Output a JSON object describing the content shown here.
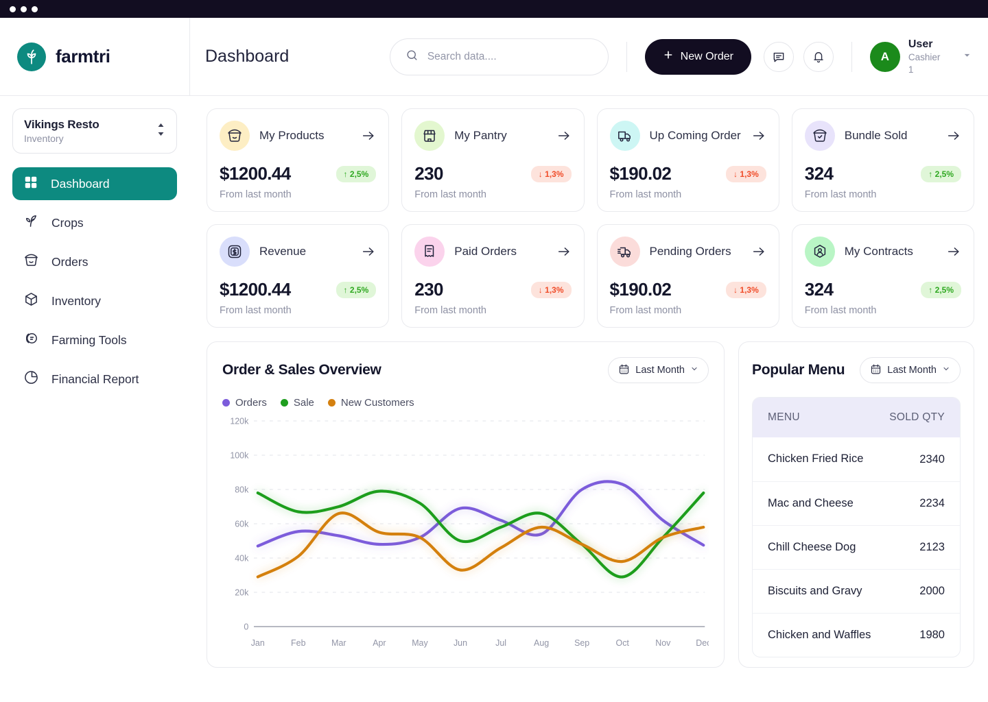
{
  "window": {
    "dots": 3
  },
  "brand": {
    "name": "farmtri",
    "logo_icon": "leaf-plant-icon",
    "color": "#0d8a80"
  },
  "header": {
    "page_title": "Dashboard",
    "search": {
      "placeholder": "Search data....",
      "value": "",
      "icon": "search-icon"
    },
    "new_order_label": "New Order",
    "chat_icon": "chat-bubble-icon",
    "bell_icon": "bell-icon",
    "avatar_initial": "A",
    "avatar_color": "#1b8a1b",
    "user_name": "User",
    "user_role": "Cashier 1",
    "caret_icon": "chevron-down-icon"
  },
  "sidebar": {
    "org": {
      "name": "Vikings Resto",
      "sub": "Inventory",
      "icon": "selector-updown-icon"
    },
    "items": [
      {
        "label": "Dashboard",
        "icon": "grid-icon",
        "active": true
      },
      {
        "label": "Crops",
        "icon": "sprout-icon",
        "active": false
      },
      {
        "label": "Orders",
        "icon": "basket-icon",
        "active": false
      },
      {
        "label": "Inventory",
        "icon": "box-icon",
        "active": false
      },
      {
        "label": "Farming Tools",
        "icon": "tools-icon",
        "active": false
      },
      {
        "label": "Financial Report",
        "icon": "pie-chart-icon",
        "active": false
      }
    ],
    "active_color": "#0d8a80"
  },
  "stats": {
    "sub_label": "From last month",
    "cards": [
      {
        "title": "My Products",
        "icon": "basket-icon",
        "icon_bg": "#fdeec4",
        "value": "$1200.44",
        "delta": "2,5%",
        "direction": "up"
      },
      {
        "title": "My Pantry",
        "icon": "store-icon",
        "icon_bg": "#e3f7cf",
        "value": "230",
        "delta": "1,3%",
        "direction": "down"
      },
      {
        "title": "Up Coming Order",
        "icon": "truck-icon",
        "icon_bg": "#cdf6f4",
        "value": "$190.02",
        "delta": "1,3%",
        "direction": "down"
      },
      {
        "title": "Bundle Sold",
        "icon": "basket-check-icon",
        "icon_bg": "#e8e3fb",
        "value": "324",
        "delta": "2,5%",
        "direction": "up"
      },
      {
        "title": "Revenue",
        "icon": "dollar-icon",
        "icon_bg": "#d9defb",
        "value": "$1200.44",
        "delta": "2,5%",
        "direction": "up"
      },
      {
        "title": "Paid Orders",
        "icon": "receipt-icon",
        "icon_bg": "#fbd3ec",
        "value": "230",
        "delta": "1,3%",
        "direction": "down"
      },
      {
        "title": "Pending Orders",
        "icon": "truck-pending-icon",
        "icon_bg": "#fbdcda",
        "value": "$190.02",
        "delta": "1,3%",
        "direction": "down"
      },
      {
        "title": "My Contracts",
        "icon": "user-badge-icon",
        "icon_bg": "#b9f5c5",
        "value": "324",
        "delta": "2,5%",
        "direction": "up"
      }
    ]
  },
  "chart_panel": {
    "title": "Order & Sales Overview",
    "period_label": "Last Month",
    "period_icon": "calendar-icon"
  },
  "chart_data": {
    "type": "line",
    "title": "Order & Sales Overview",
    "xlabel": "",
    "ylabel": "",
    "categories": [
      "Jan",
      "Feb",
      "Mar",
      "Apr",
      "May",
      "Jun",
      "Jul",
      "Aug",
      "Sep",
      "Oct",
      "Nov",
      "Dec"
    ],
    "ylim": [
      0,
      120000
    ],
    "yticks": [
      "0",
      "20k",
      "40k",
      "60k",
      "80k",
      "100k",
      "120k"
    ],
    "ytick_values": [
      0,
      20000,
      40000,
      60000,
      80000,
      100000,
      120000
    ],
    "grid": true,
    "legend_position": "top-left",
    "series": [
      {
        "name": "Orders",
        "color": "#7c5cdb",
        "values": [
          47000,
          55500,
          53000,
          48000,
          52000,
          69000,
          62000,
          54000,
          80000,
          83000,
          62000,
          47500
        ]
      },
      {
        "name": "Sale",
        "color": "#1f9e1f",
        "values": [
          78000,
          67000,
          70000,
          79000,
          72000,
          50000,
          58000,
          66000,
          48000,
          29000,
          52000,
          78000
        ]
      },
      {
        "name": "New Customers",
        "color": "#d4800f",
        "values": [
          29000,
          41000,
          66000,
          55000,
          52000,
          33000,
          46000,
          58000,
          48000,
          38000,
          52000,
          58000
        ]
      }
    ]
  },
  "menu_panel": {
    "title": "Popular Menu",
    "period_label": "Last Month",
    "period_icon": "calendar-icon",
    "columns": [
      "MENU",
      "SOLD QTY"
    ],
    "rows": [
      {
        "name": "Chicken Fried Rice",
        "qty": "2340"
      },
      {
        "name": "Mac and Cheese",
        "qty": "2234"
      },
      {
        "name": "Chill Cheese Dog",
        "qty": "2123"
      },
      {
        "name": "Biscuits and Gravy",
        "qty": "2000"
      },
      {
        "name": "Chicken and Waffles",
        "qty": "1980"
      }
    ]
  }
}
